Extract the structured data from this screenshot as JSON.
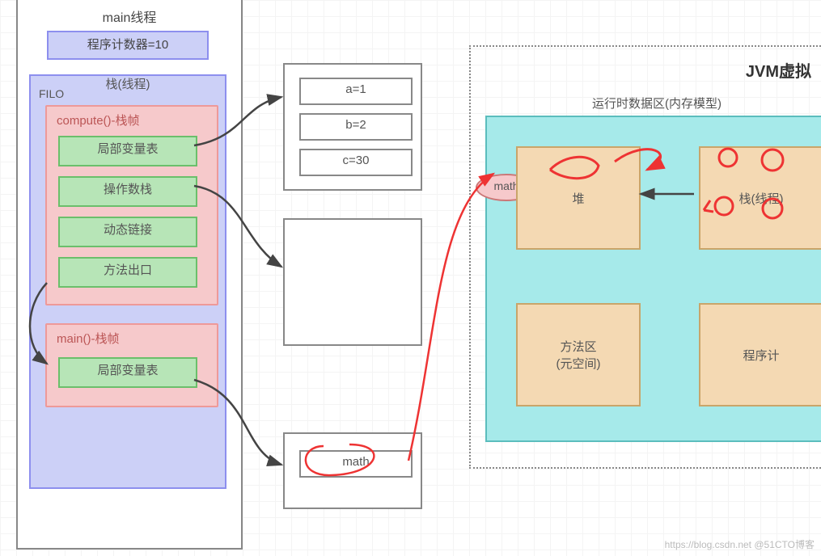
{
  "leftPanel": {
    "title": "main线程",
    "programCounter": "程序计数器=10",
    "stack": {
      "filo": "FILO",
      "title": "栈(线程)",
      "frames": [
        {
          "title": "compute()-栈帧",
          "slots": [
            "局部变量表",
            "操作数栈",
            "动态链接",
            "方法出口"
          ]
        },
        {
          "title": "main()-栈帧",
          "slots": [
            "局部变量表"
          ]
        }
      ]
    }
  },
  "middleBoxes": {
    "box1": [
      "a=1",
      "b=2",
      "c=30"
    ],
    "box3_item": "math"
  },
  "jvm": {
    "title": "JVM虚拟",
    "runtimeTitle": "运行时数据区(内存模型)",
    "mathLabel": "math",
    "heap": "堆",
    "stack": "栈(线程)",
    "methodArea": "方法区\n(元空间)",
    "pc": "程序计"
  },
  "watermark": "https://blog.csdn.net @51CTO博客"
}
